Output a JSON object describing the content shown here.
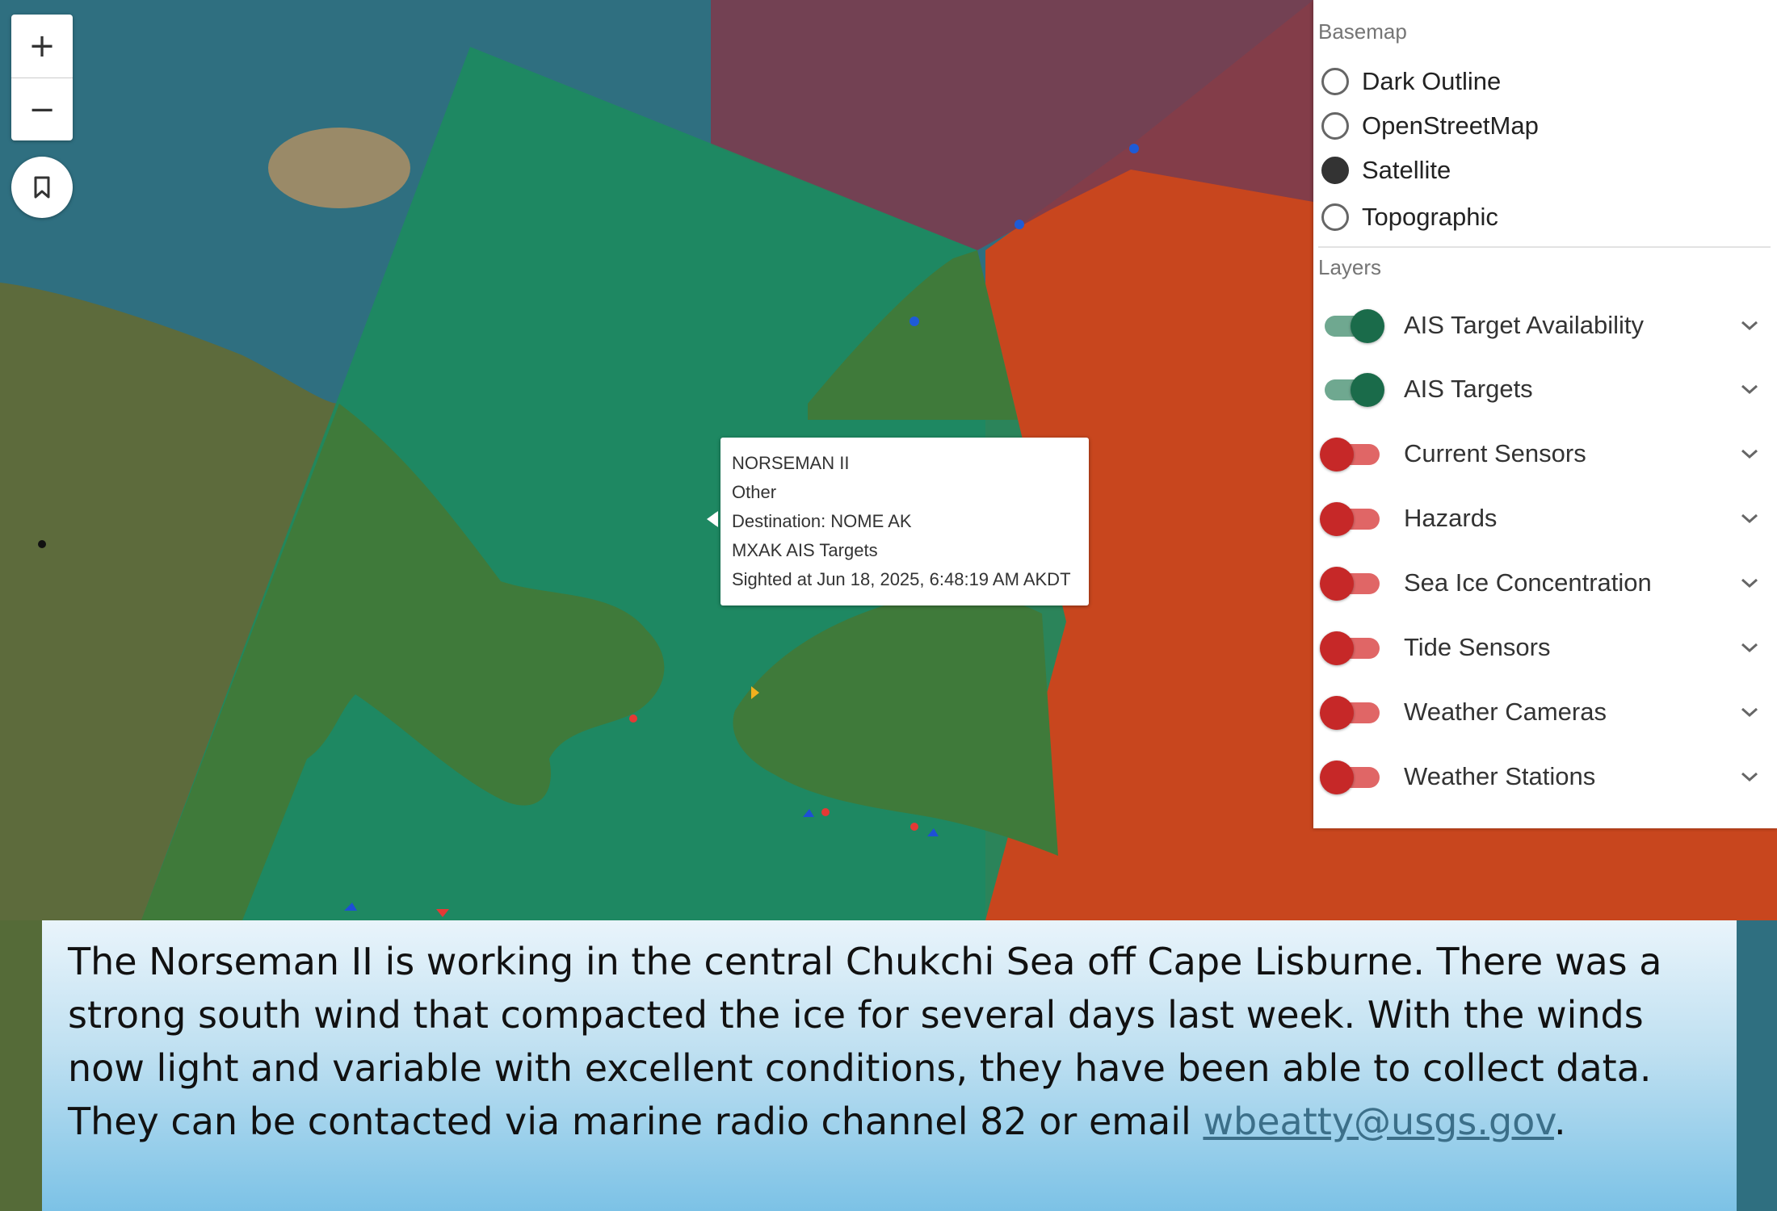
{
  "map": {
    "zoom_in_label": "+",
    "zoom_out_label": "−",
    "bookmark_icon": "bookmark-icon",
    "colors": {
      "sea": "#2f6f80",
      "land": "#4f6a3a",
      "coverage_green": "#1f8a5e",
      "coverage_red": "#d6451c",
      "coverage_purple": "#8a4a5c"
    }
  },
  "popup": {
    "vessel": "NORSEMAN II",
    "type": "Other",
    "destination": "Destination: NOME AK",
    "source": "MXAK AIS Targets",
    "sighted": "Sighted at Jun 18, 2025, 6:48:19 AM AKDT"
  },
  "panel": {
    "basemap_title": "Basemap",
    "basemaps": [
      {
        "label": "Dark Outline",
        "checked": false
      },
      {
        "label": "OpenStreetMap",
        "checked": false
      },
      {
        "label": "Satellite",
        "checked": true
      },
      {
        "label": "Topographic",
        "checked": false
      }
    ],
    "layers_title": "Layers",
    "layers": [
      {
        "label": "AIS Target Availability",
        "on": true
      },
      {
        "label": "AIS Targets",
        "on": true
      },
      {
        "label": "Current Sensors",
        "on": false
      },
      {
        "label": "Hazards",
        "on": false
      },
      {
        "label": "Sea Ice Concentration",
        "on": false
      },
      {
        "label": "Tide Sensors",
        "on": false
      },
      {
        "label": "Weather Cameras",
        "on": false
      },
      {
        "label": "Weather Stations",
        "on": false
      }
    ]
  },
  "caption": {
    "text": "The Norseman II is working in the central Chukchi Sea off Cape Lisburne.  There was a strong south wind that compacted the ice for several days last week. With the  winds now light and variable with excellent conditions, they have been able to collect data. They can be contacted via marine radio channel 82 or email ",
    "email": "wbeatty@usgs.gov",
    "end": "."
  }
}
